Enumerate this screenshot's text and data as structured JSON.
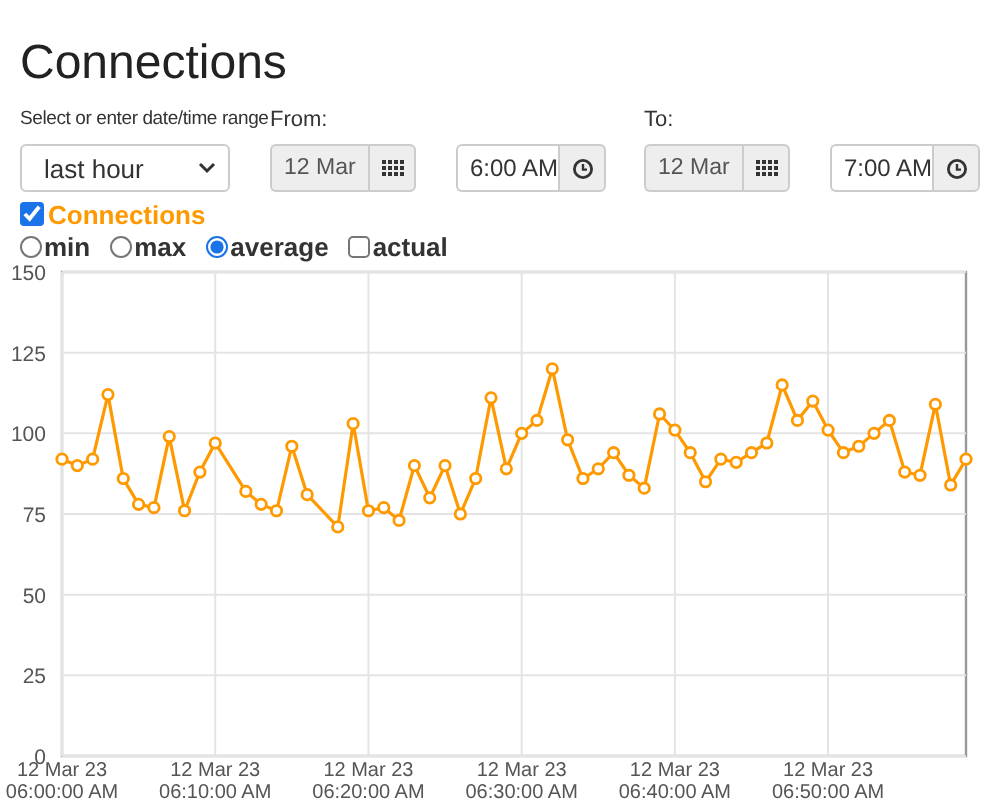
{
  "title": "Connections",
  "range": {
    "label": "Select or enter date/time range",
    "value": "last hour"
  },
  "from": {
    "label": "From:",
    "date": "12 Mar",
    "time": "6:00 AM"
  },
  "to": {
    "label": "To:",
    "date": "12 Mar",
    "time": "7:00 AM"
  },
  "series_toggle": {
    "checked": true
  },
  "modes": [
    {
      "kind": "radio",
      "label": "min",
      "selected": false
    },
    {
      "kind": "radio",
      "label": "max",
      "selected": false
    },
    {
      "kind": "radio",
      "label": "average",
      "selected": true
    },
    {
      "kind": "checkbox",
      "label": "actual",
      "checked": false
    }
  ],
  "chart_data": {
    "type": "line",
    "grid": true,
    "ylim": [
      0,
      150
    ],
    "yticks": [
      0,
      25,
      50,
      75,
      100,
      125,
      150
    ],
    "categories": [
      "12 Mar 23 06:00:00 AM",
      null,
      null,
      null,
      null,
      null,
      null,
      null,
      null,
      null,
      "12 Mar 23 06:10:00 AM",
      null,
      null,
      null,
      null,
      null,
      null,
      null,
      null,
      null,
      "12 Mar 23 06:20:00 AM",
      null,
      null,
      null,
      null,
      null,
      null,
      null,
      null,
      null,
      "12 Mar 23 06:30:00 AM",
      null,
      null,
      null,
      null,
      null,
      null,
      null,
      null,
      null,
      "12 Mar 23 06:40:00 AM",
      null,
      null,
      null,
      null,
      null,
      null,
      null,
      null,
      null,
      "12 Mar 23 06:50:00 AM",
      null,
      null,
      null,
      null,
      null,
      null,
      null,
      null,
      null
    ],
    "series": [
      {
        "name": "Connections",
        "color": "#ff9900",
        "marker": "circle",
        "values": [
          92,
          90,
          92,
          112,
          86,
          78,
          77,
          99,
          76,
          88,
          97,
          null,
          82,
          78,
          76,
          96,
          81,
          null,
          71,
          103,
          76,
          77,
          73,
          90,
          80,
          90,
          75,
          86,
          111,
          89,
          100,
          104,
          120,
          98,
          86,
          89,
          94,
          87,
          83,
          106,
          101,
          94,
          85,
          92,
          91,
          94,
          97,
          115,
          104,
          110,
          101,
          94,
          96,
          100,
          104,
          88,
          87,
          109,
          84,
          92
        ]
      }
    ]
  }
}
